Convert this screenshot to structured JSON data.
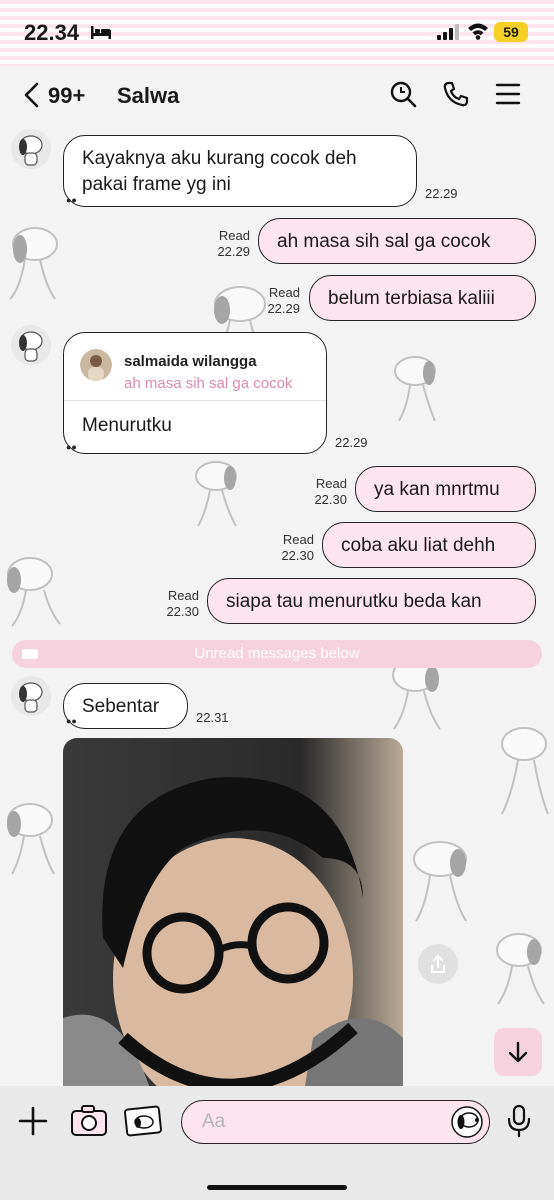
{
  "status": {
    "time": "22.34",
    "battery": "59"
  },
  "header": {
    "back_count": "99+",
    "title": "Salwa"
  },
  "messages": {
    "m1": {
      "line1": "Kayaknya aku kurang cocok deh",
      "line2": "pakai frame yg ini",
      "time": "22.29"
    },
    "m2": {
      "text": "ah masa sih sal ga cocok",
      "read": "Read",
      "time": "22.29"
    },
    "m3": {
      "text": "belum terbiasa kaliii",
      "read": "Read",
      "time": "22.29"
    },
    "m4": {
      "reply_name": "salmaida wilangga",
      "reply_text": "ah masa sih sal ga cocok",
      "text": "Menurutku",
      "time": "22.29"
    },
    "m5": {
      "text": "ya kan mnrtmu",
      "read": "Read",
      "time": "22.30"
    },
    "m6": {
      "text": "coba aku liat dehh",
      "read": "Read",
      "time": "22.30"
    },
    "m7": {
      "text": "siapa tau menurutku beda kan",
      "read": "Read",
      "time": "22.30"
    },
    "m8": {
      "text": "Sebentar",
      "time": "22.31"
    }
  },
  "unread_banner": "Unread messages below",
  "composer": {
    "placeholder": "Aa"
  },
  "colors": {
    "outgoing_bubble": "#fde4ee",
    "accent_pink": "#f6d1de",
    "battery": "#f5cf26"
  }
}
